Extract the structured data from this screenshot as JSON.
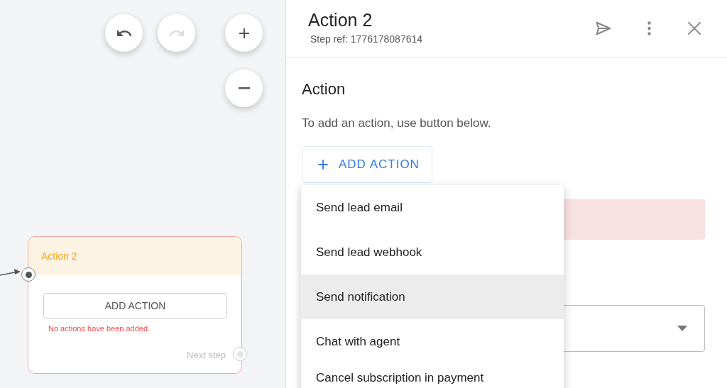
{
  "canvas": {
    "history_buttons": [
      {
        "kind": "undo",
        "disabled": false
      },
      {
        "kind": "redo",
        "disabled": true
      }
    ],
    "zoom_buttons": [
      {
        "kind": "zoom-in"
      },
      {
        "kind": "zoom-out"
      }
    ],
    "node": {
      "title": "Action 2",
      "button": "ADD ACTION",
      "error": "No actions have been added.",
      "next_label": "Next step"
    }
  },
  "panel": {
    "title": "Action 2",
    "step_ref": "Step ref: 1776178087614",
    "section_title": "Action",
    "hint": "To add an action, use button below.",
    "add_button": "ADD ACTION",
    "menu": [
      {
        "label": "Send lead email",
        "selected": false
      },
      {
        "label": "Send lead webhook",
        "selected": false
      },
      {
        "label": "Send notification",
        "selected": true
      },
      {
        "label": "Chat with agent",
        "selected": false
      },
      {
        "label": "Cancel subscription in payment",
        "selected": false
      }
    ]
  }
}
